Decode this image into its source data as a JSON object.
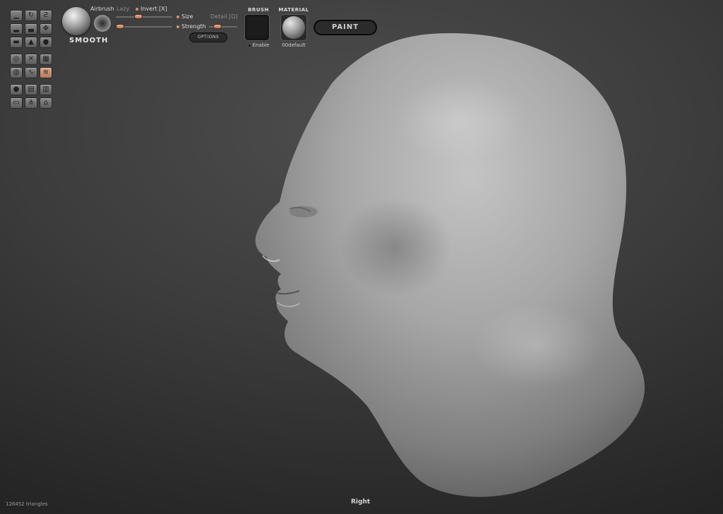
{
  "tools": {
    "group1": [
      "standard-brush-icon",
      "rotate-brush-icon",
      "crease-brush-icon",
      "clay-brush-icon",
      "inflate-brush-icon",
      "grab-brush-icon",
      "flatten-brush-icon",
      "pinch-brush-icon",
      "blob-brush-icon"
    ],
    "group2": [
      "smooth-ring-icon",
      "mask-icon",
      "grid-icon",
      "pinch-circle-icon",
      "wave-icon",
      "smooth-brush-icon"
    ],
    "group3": [
      "sphere-icon",
      "layer-icon",
      "paint-layer-icon",
      "hide-icon",
      "symmetry-icon",
      "reset-icon"
    ]
  },
  "brush": {
    "name": "SMOOTH",
    "airbrush_label": "Airbrush",
    "lazy_label": "Lazy",
    "invert_label": "Invert [X]",
    "size_label": "Size",
    "detail_label": "Detail [Q]",
    "strength_label": "Strength",
    "options_label": "OPTIONS"
  },
  "brush_section": {
    "title": "BRUSH",
    "enable_label": "Enable"
  },
  "material": {
    "title": "MATERIAL",
    "name": "00default"
  },
  "paint_label": "PAINT",
  "status": {
    "triangles": "126452 triangles",
    "view": "Right"
  },
  "colors": {
    "accent": "#d9916b",
    "background": "#3c3c3c"
  }
}
